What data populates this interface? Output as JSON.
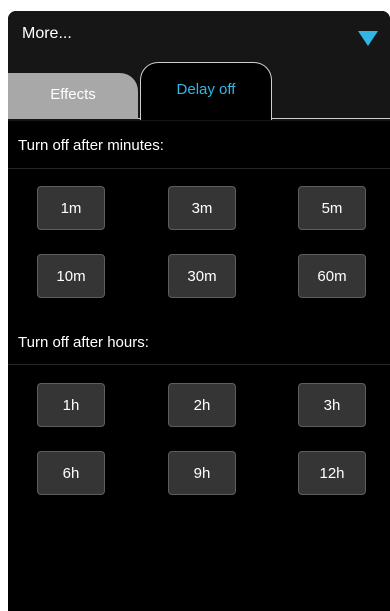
{
  "header": {
    "title": "More...",
    "dropdown_icon": "triangle-down-icon",
    "accent_color": "#33b5e5"
  },
  "tabs": [
    {
      "label": "Effects",
      "active": false
    },
    {
      "label": "Delay off",
      "active": true
    }
  ],
  "minutes_section": {
    "label": "Turn off after minutes:",
    "options": [
      "1m",
      "3m",
      "5m",
      "10m",
      "30m",
      "60m"
    ]
  },
  "hours_section": {
    "label": "Turn off after hours:",
    "options": [
      "1h",
      "2h",
      "3h",
      "6h",
      "9h",
      "12h"
    ]
  }
}
